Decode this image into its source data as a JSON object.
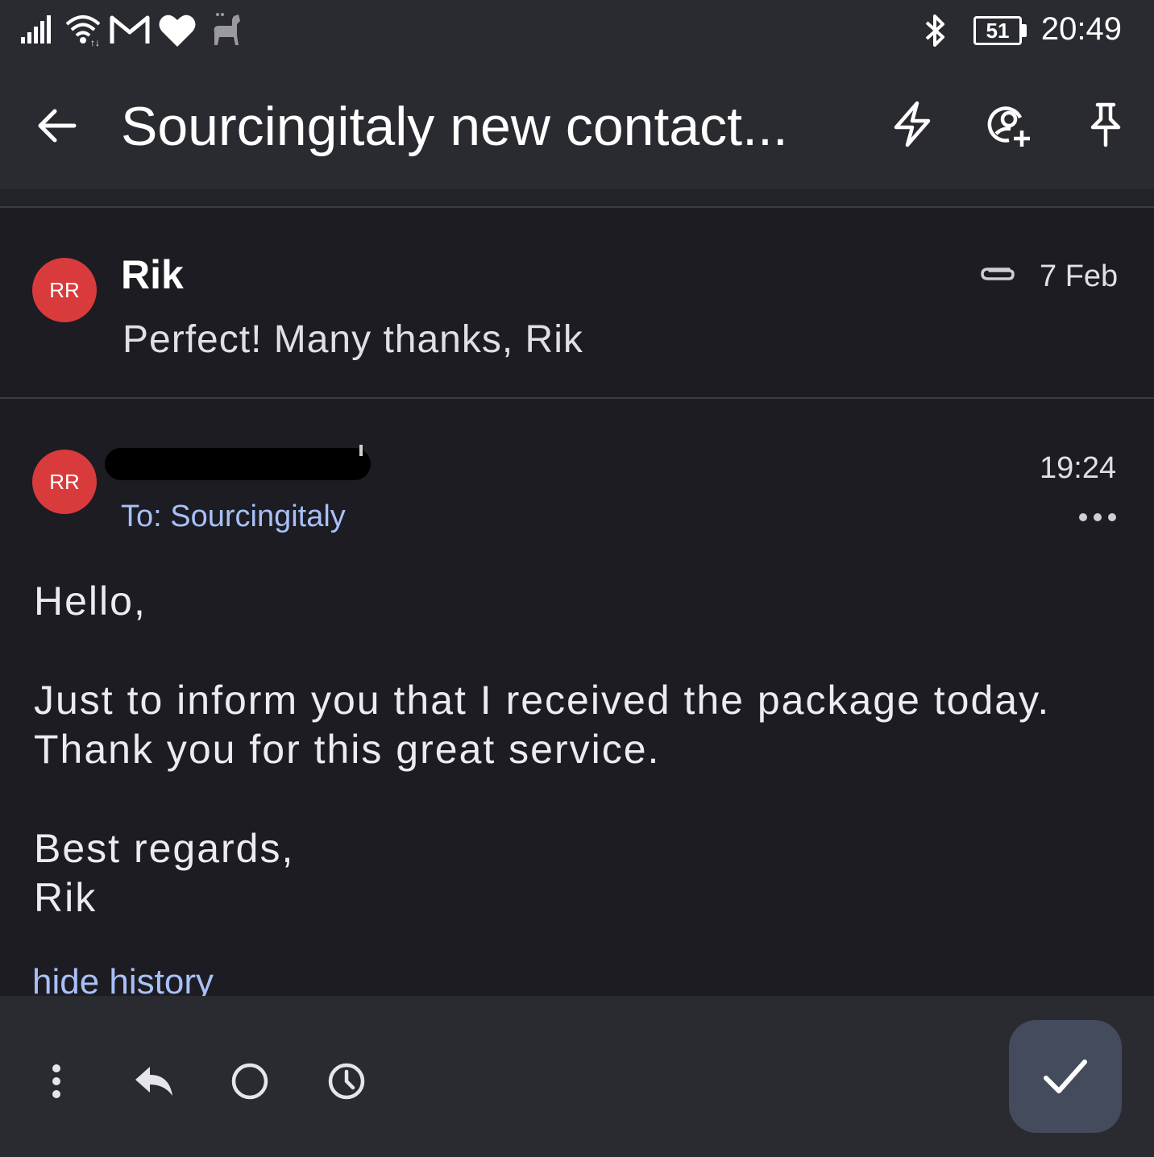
{
  "status_bar": {
    "time": "20:49",
    "battery_level": "51",
    "icons": [
      "signal-icon",
      "wifi-icon",
      "gmail-icon",
      "heart-icon",
      "llama-icon",
      "bluetooth-icon"
    ]
  },
  "app_bar": {
    "title": "Sourcingitaly new contact...",
    "actions": [
      "lightning-icon",
      "add-contact-icon",
      "pin-icon"
    ]
  },
  "thread": {
    "messages": [
      {
        "avatar_initials": "RR",
        "sender": "Rik",
        "date": "7 Feb",
        "has_attachment": true,
        "snippet": "Perfect! Many thanks, Rik"
      },
      {
        "avatar_initials": "RR",
        "sender_redacted": true,
        "date": "19:24",
        "to": "To: Sourcingitaly",
        "body": {
          "greeting": "Hello,",
          "line1": "Just to inform you that I received the package today.",
          "line2": "Thank you for this great service.",
          "closing": "Best regards,",
          "signature": "Rik"
        },
        "hide_history_label": "hide history"
      }
    ]
  },
  "toolbar": {
    "buttons": [
      "more-vert-icon",
      "reply-icon",
      "circle-icon",
      "clock-icon"
    ],
    "done_icon": "check-icon"
  },
  "colors": {
    "background": "#1c1c22",
    "bar": "#2a2b31",
    "avatar": "#d93b3d",
    "link": "#a8c0f7",
    "fab": "#434b5d"
  }
}
